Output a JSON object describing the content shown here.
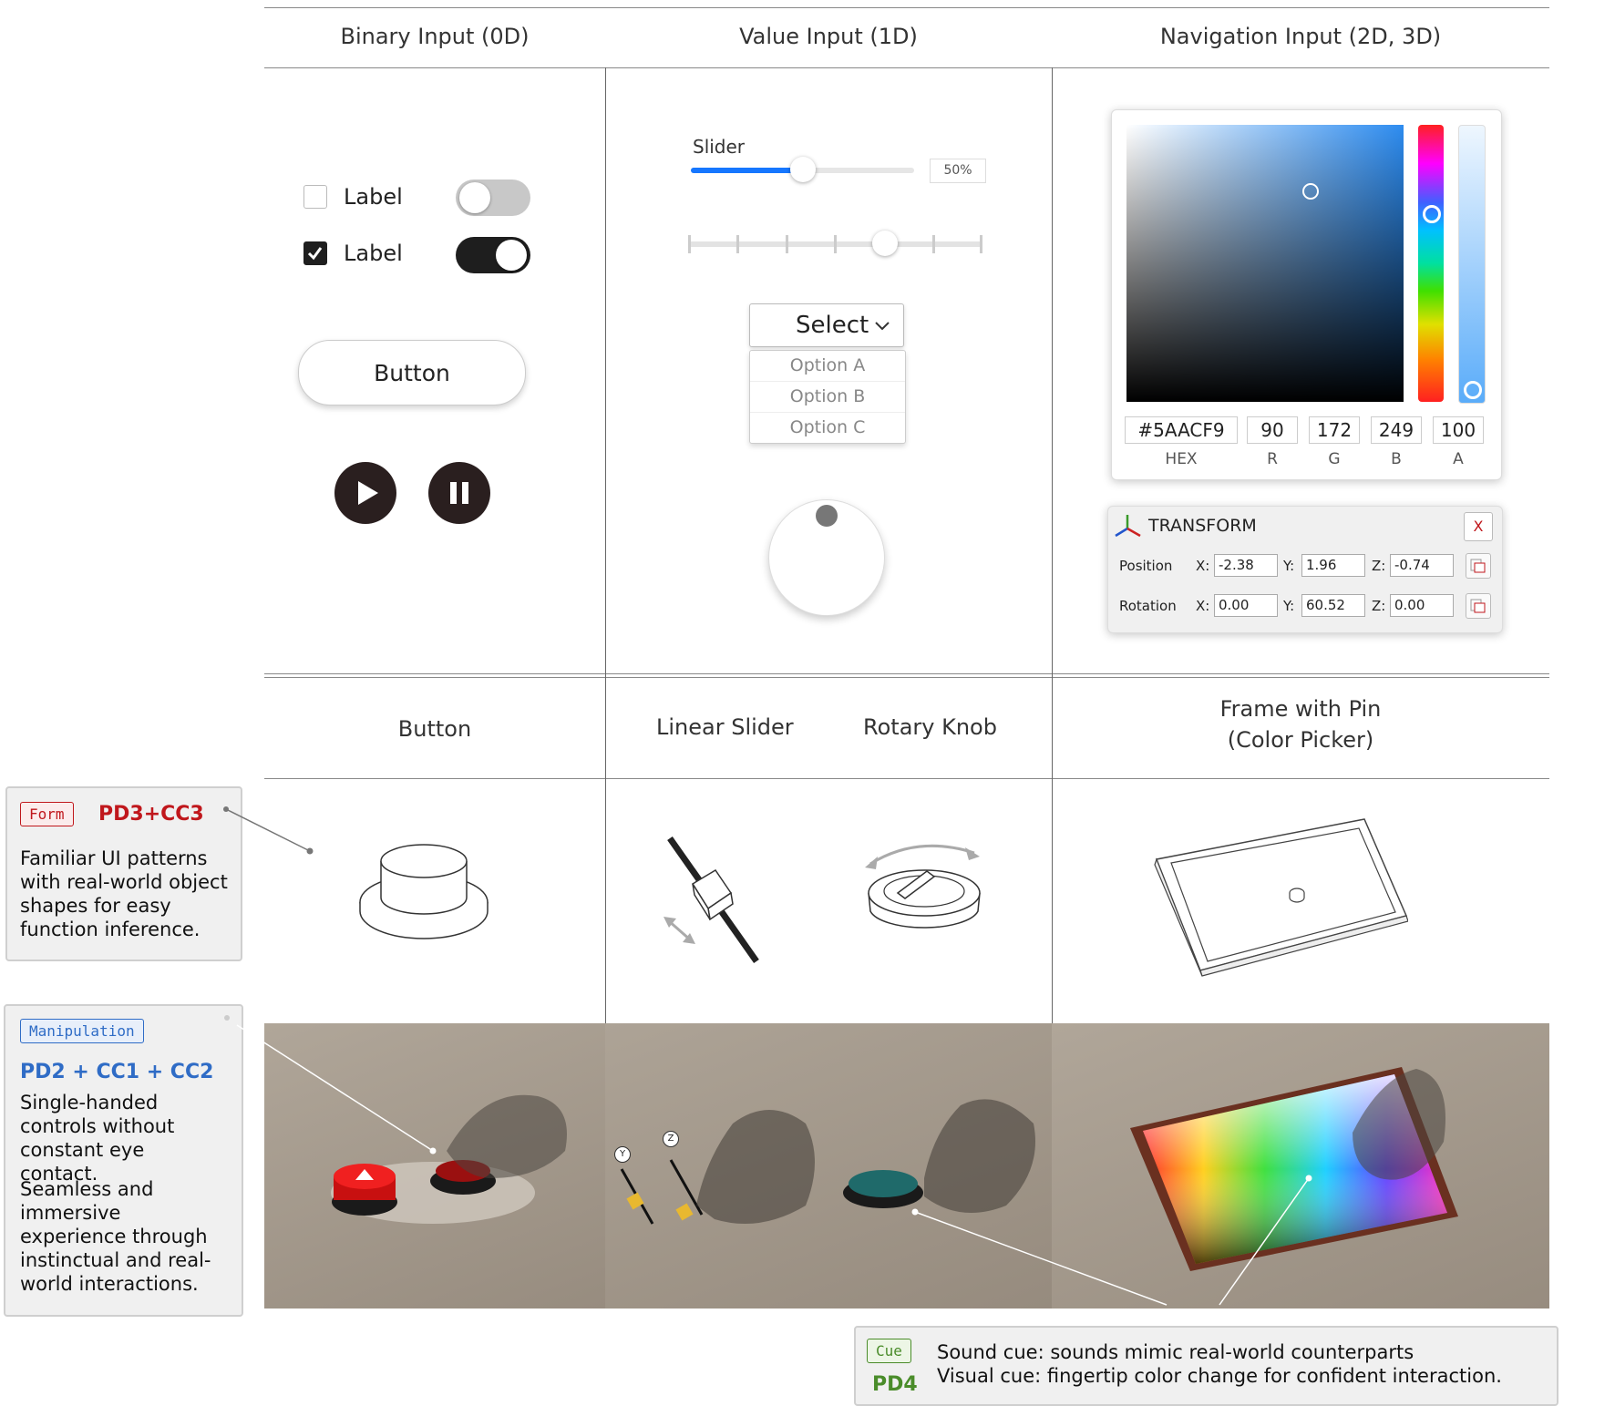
{
  "columns": {
    "binary": "Binary Input (0D)",
    "value": "Value Input (1D)",
    "navigation": "Navigation Input (2D, 3D)"
  },
  "binary": {
    "checkbox1_label": "Label",
    "checkbox2_label": "Label",
    "button_label": "Button",
    "checkbox1_checked": false,
    "checkbox2_checked": true,
    "toggle1_on": false,
    "toggle2_on": true,
    "play_icon": "play-icon",
    "pause_icon": "pause-icon"
  },
  "value": {
    "slider_label": "Slider",
    "slider_value": "50%",
    "slider_fraction": 0.5,
    "step_slider_fraction": 0.67,
    "select_label": "Select",
    "options": [
      "Option A",
      "Option B",
      "Option C"
    ]
  },
  "color_picker": {
    "hex": "#5AACF9",
    "r": "90",
    "g": "172",
    "b": "249",
    "a": "100",
    "labels": {
      "hex": "HEX",
      "r": "R",
      "g": "G",
      "b": "B",
      "a": "A"
    }
  },
  "transform": {
    "title": "TRANSFORM",
    "close": "X",
    "position_label": "Position",
    "rotation_label": "Rotation",
    "axis_x": "X:",
    "axis_y": "Y:",
    "axis_z": "Z:",
    "position": {
      "x": "-2.38",
      "y": "1.96",
      "z": "-0.74"
    },
    "rotation": {
      "x": "0.00",
      "y": "60.52",
      "z": "0.00"
    }
  },
  "physical": {
    "button": "Button",
    "linear_slider": "Linear Slider",
    "rotary_knob": "Rotary Knob",
    "frame_line1": "Frame with Pin",
    "frame_line2": "(Color Picker)"
  },
  "annotations": {
    "form": {
      "tag": "Form",
      "code": "PD3+CC3",
      "text": "Familiar UI patterns with real-world object shapes for easy function inference."
    },
    "manipulation": {
      "tag": "Manipulation",
      "code": "PD2 + CC1 + CC2",
      "text1": "Single-handed controls without constant eye contact.",
      "text2": "Seamless and immersive experience through instinctual and real-world interactions."
    },
    "cue": {
      "tag": "Cue",
      "code": "PD4",
      "line1": "Sound cue: sounds mimic real-world counterparts",
      "line2": "Visual cue: fingertip color change for confident interaction."
    }
  },
  "scene_labels": {
    "y": "Y",
    "z": "Z"
  },
  "colors": {
    "slider_blue": "#1677ff",
    "form_red": "#c0171c",
    "manip_blue": "#2f6cc6",
    "cue_green": "#4a8c2a",
    "floor": "#a79d90"
  }
}
